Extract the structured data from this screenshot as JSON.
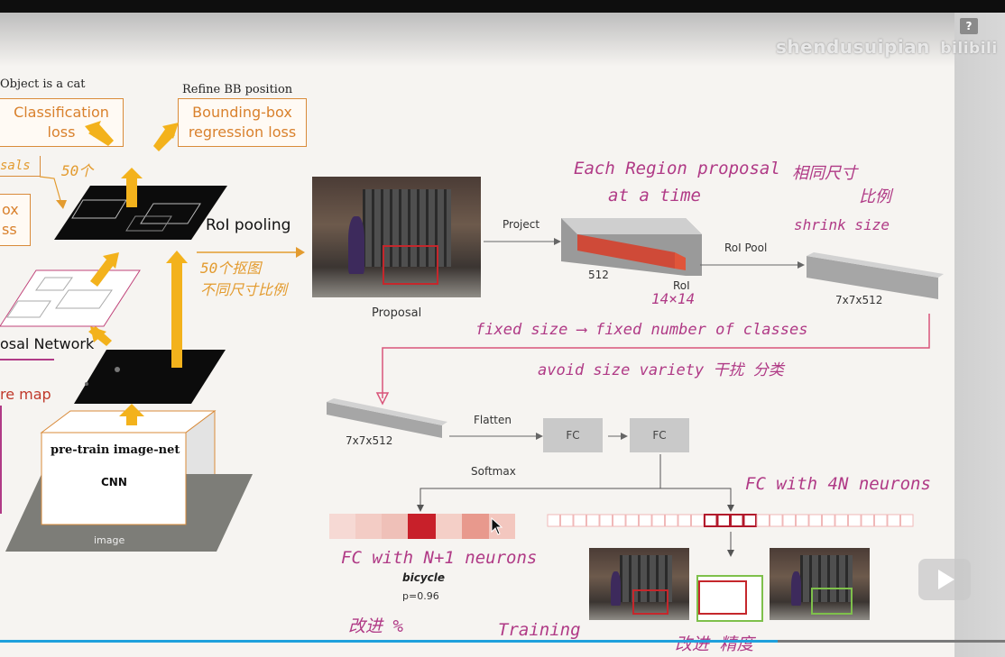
{
  "overlay": {
    "watermark": "shendusuipian",
    "watermark_logo": "bilibili",
    "help": "?",
    "icons": [
      "help-icon",
      "play-icon",
      "bilibili-logo-icon"
    ]
  },
  "left_panel": {
    "obj_cat": "Object is a cat",
    "refine_bb": "Refine BB position",
    "classification_loss": "Classification loss",
    "classification_loss_l1": "Classification",
    "classification_loss_l2": "loss",
    "bbox_reg_l1": "Bounding-box",
    "bbox_reg_l2": "regression loss",
    "proposals_partial": "sals",
    "box_partial_l1": "ox",
    "box_partial_l2": "ss",
    "roi_pooling": "RoI pooling",
    "rpn_partial": "osal Network",
    "feature_map_partial": "re map",
    "pretrain": "pre-train  image-net",
    "cnn": "CNN",
    "image": "image",
    "hand_50ge": "50个",
    "hand_50kuang_l1": "50个抠图",
    "hand_50kuang_l2": "不同尺寸比例"
  },
  "right_panel": {
    "proposal": "Proposal",
    "project": "Project",
    "dim_512": "512",
    "roi": "RoI",
    "roi_pool": "RoI Pool",
    "dim_7x7x512_a": "7x7x512",
    "dim_7x7x512_b": "7x7x512",
    "flatten": "Flatten",
    "fc1": "FC",
    "fc2": "FC",
    "softmax": "Softmax",
    "bicycle": "bicycle",
    "prob": "p=0.96",
    "hand_each_region_l1": "Each Region proposal",
    "hand_each_region_l2": "at a time",
    "hand_same_size_l1": "相同尺寸",
    "hand_same_size_l2": "比例",
    "hand_shrink": "shrink size",
    "hand_14x14": "14×14",
    "hand_fixed": "fixed size  ⟶  fixed number of classes",
    "hand_avoid": "avoid size variety 干扰 分类",
    "hand_fc4n": "FC with 4N neurons",
    "hand_fcn1": "FC with N+1 neurons",
    "hand_gaijin1": "改进 %",
    "hand_training": "Training",
    "hand_gaijin2": "改进 精度"
  },
  "softmax_bar": {
    "cells": [
      "#f6d9d4",
      "#f3ccc5",
      "#efc0b8",
      "#c8202a",
      "#f4cfc7",
      "#e8998d",
      "#f3c7bf"
    ]
  },
  "progress": {
    "played_fraction": 0.774
  }
}
